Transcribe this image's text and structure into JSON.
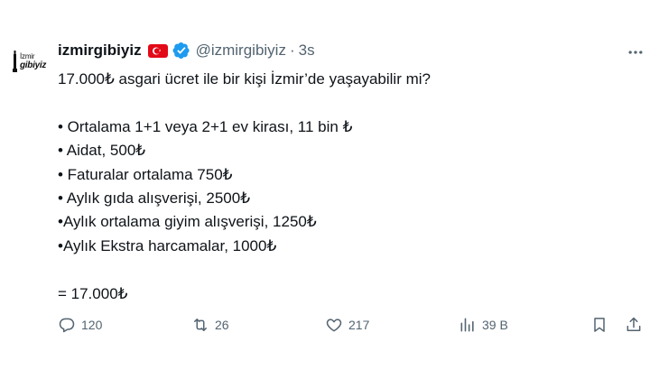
{
  "author": {
    "avatar_text_top": "İzmir",
    "avatar_text_bottom": "gibiyiz",
    "display_name": "izmirgibiyiz",
    "handle": "@izmirgibiyiz",
    "separator": "·",
    "time": "3s"
  },
  "tweet": {
    "lines": [
      "17.000₺ asgari ücret ile bir kişi İzmir’de yaşayabilir mi?",
      "",
      "• Ortalama 1+1 veya 2+1 ev kirası, 11 bin ₺",
      "• Aidat, 500₺",
      "• Faturalar ortalama 750₺",
      "• Aylık gıda alışverişi, 2500₺",
      "•Aylık ortalama giyim alışverişi, 1250₺",
      "•Aylık Ekstra harcamalar, 1000₺",
      "",
      "= 17.000₺"
    ]
  },
  "actions": {
    "replies": "120",
    "reposts": "26",
    "likes": "217",
    "views": "39 B"
  },
  "icons": {
    "reply": "reply-icon",
    "repost": "repost-icon",
    "like": "heart-icon",
    "views": "views-icon",
    "bookmark": "bookmark-icon",
    "share": "share-icon",
    "more": "more-icon",
    "verified": "verified-badge-icon",
    "flag": "turkey-flag-icon"
  },
  "colors": {
    "text": "#0f1419",
    "secondary": "#536471",
    "verified": "#1d9bf0",
    "flag": "#e30a17"
  }
}
